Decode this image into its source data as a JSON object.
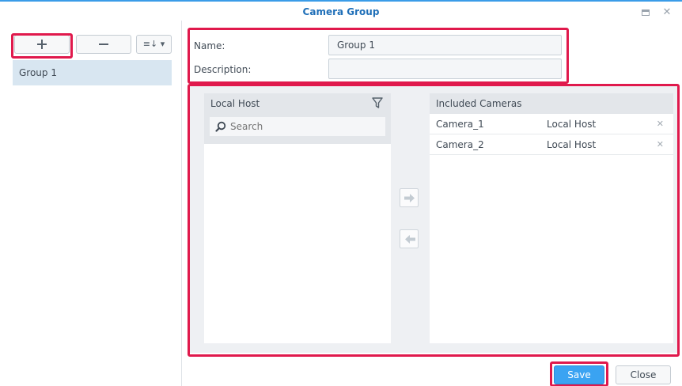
{
  "window": {
    "title": "Camera Group"
  },
  "sidebar": {
    "sort_label": "≡↓ ▾",
    "groups": [
      {
        "label": "Group 1",
        "selected": true
      }
    ]
  },
  "form": {
    "name_label": "Name:",
    "name_value": "Group 1",
    "description_label": "Description:",
    "description_value": ""
  },
  "local_panel": {
    "title": "Local Host",
    "search_placeholder": "Search"
  },
  "included_panel": {
    "title": "Included Cameras",
    "cameras": [
      {
        "name": "Camera_1",
        "host": "Local Host"
      },
      {
        "name": "Camera_2",
        "host": "Local Host"
      }
    ]
  },
  "footer": {
    "save_label": "Save",
    "close_label": "Close"
  },
  "colors": {
    "accent": "#3aa3f2",
    "highlight": "#e0194c",
    "title": "#1f6fb8"
  }
}
